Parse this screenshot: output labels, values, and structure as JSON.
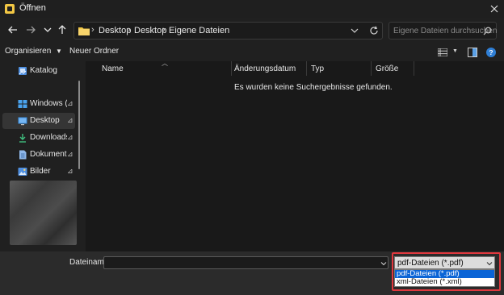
{
  "window": {
    "title": "Öffnen",
    "close_glyph": "✕"
  },
  "nav": {
    "breadcrumbs": [
      "Desktop",
      "Desktop",
      "Eigene Dateien"
    ],
    "search_placeholder": "Eigene Dateien durchsuchen"
  },
  "toolbar": {
    "organize_label": "Organisieren",
    "new_folder_label": "Neuer Ordner"
  },
  "sidebar": {
    "items": [
      {
        "label": "Katalog",
        "icon": "catalog-icon",
        "pinned": false,
        "selected": false
      },
      {
        "label": "Windows (C:",
        "icon": "drive-icon",
        "pinned": true,
        "selected": false
      },
      {
        "label": "Desktop",
        "icon": "desktop-icon",
        "pinned": true,
        "selected": true
      },
      {
        "label": "Downloads",
        "icon": "download-icon",
        "pinned": true,
        "selected": false
      },
      {
        "label": "Dokumente",
        "icon": "document-icon",
        "pinned": true,
        "selected": false
      },
      {
        "label": "Bilder",
        "icon": "pictures-icon",
        "pinned": true,
        "selected": false
      }
    ],
    "pin_glyph": "📌"
  },
  "filelist": {
    "columns": [
      "Name",
      "Änderungsdatum",
      "Typ",
      "Größe"
    ],
    "empty_message": "Es wurden keine Suchergebnisse gefunden."
  },
  "bottom": {
    "filename_label": "Dateiname:",
    "filename_value": "",
    "filetype_selected": "pdf-Dateien (*.pdf)",
    "filetype_options": [
      "pdf-Dateien (*.pdf)",
      "xml-Dateien (*.xml)"
    ],
    "highlight_color": "#e0383e",
    "selection_color": "#0a64d6"
  }
}
